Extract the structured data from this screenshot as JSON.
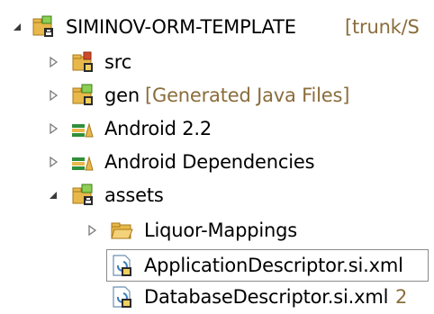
{
  "tree": {
    "items": [
      {
        "label": "SIMINOV-ORM-TEMPLATE",
        "decoration": "[trunk/S",
        "icon": "android-project-icon",
        "expanded": true
      },
      {
        "label": "src",
        "decoration": "",
        "icon": "source-folder-icon",
        "expanded": false
      },
      {
        "label": "gen",
        "decoration": "[Generated Java Files]",
        "icon": "gen-folder-icon",
        "expanded": false
      },
      {
        "label": "Android 2.2",
        "decoration": "",
        "icon": "library-icon",
        "expanded": false
      },
      {
        "label": "Android Dependencies",
        "decoration": "",
        "icon": "library-icon",
        "expanded": false
      },
      {
        "label": "assets",
        "decoration": "",
        "icon": "versioned-folder-icon",
        "expanded": true
      },
      {
        "label": "Liquor-Mappings",
        "decoration": "",
        "icon": "folder-icon",
        "expanded": false
      },
      {
        "label": "ApplicationDescriptor.si.xml",
        "decoration": "",
        "icon": "xml-file-icon",
        "selected": true
      },
      {
        "label": "DatabaseDescriptor.si.xml",
        "decoration": "2",
        "icon": "xml-file-icon"
      }
    ]
  },
  "colors": {
    "decoration": "#8a6d3b",
    "selection_border": "#8b8b8b",
    "folder": "#e8b84a",
    "library": "#2f8f3a"
  }
}
